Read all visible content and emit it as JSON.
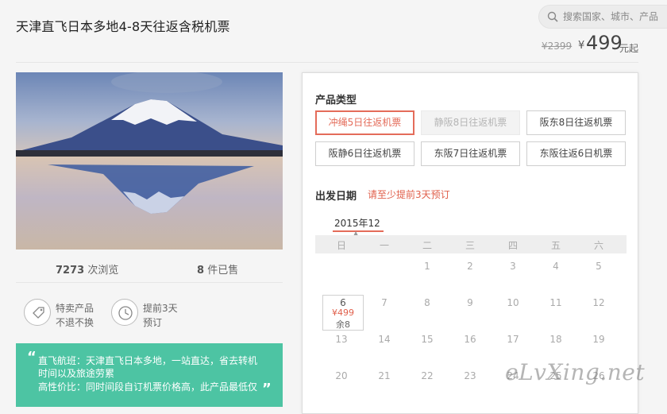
{
  "header": {
    "title": "天津直飞日本多地4-8天往返含税机票",
    "search_placeholder": "搜索国家、城市、产品",
    "old_price": "¥2399",
    "currency": "¥",
    "price": "499",
    "price_suffix": "元起"
  },
  "stats": {
    "views_count": "7273",
    "views_label": "次浏览",
    "sold_count": "8",
    "sold_label": "件已售"
  },
  "features": [
    {
      "icon": "tag-icon",
      "line1": "特卖产品",
      "line2": "不退不换"
    },
    {
      "icon": "clock-icon",
      "line1": "提前3天",
      "line2": "预订"
    }
  ],
  "quote": {
    "line1": "直飞航班：天津直飞日本多地，一站直达，省去转机",
    "line2": "时间以及旅途劳累",
    "line3": "高性价比：同时间段自订机票价格高，此产品最低仅"
  },
  "product_types": {
    "label": "产品类型",
    "options": [
      {
        "label": "冲绳5日往返机票",
        "state": "selected"
      },
      {
        "label": "静阪8日往返机票",
        "state": "disabled"
      },
      {
        "label": "阪东8日往返机票",
        "state": "normal"
      },
      {
        "label": "阪静6日往返机票",
        "state": "normal"
      },
      {
        "label": "东阪7日往返机票",
        "state": "normal"
      },
      {
        "label": "东阪往返6日机票",
        "state": "normal"
      }
    ]
  },
  "departure": {
    "label": "出发日期",
    "hint": "请至少提前3天预订",
    "month": "2015年12",
    "weekdays": [
      "日",
      "一",
      "二",
      "三",
      "四",
      "五",
      "六"
    ],
    "weeks": [
      [
        "",
        "",
        "1",
        "2",
        "3",
        "4",
        "5"
      ],
      [
        "6",
        "7",
        "8",
        "9",
        "10",
        "11",
        "12"
      ],
      [
        "13",
        "14",
        "15",
        "16",
        "17",
        "18",
        "19"
      ],
      [
        "20",
        "21",
        "22",
        "23",
        "24",
        "25",
        "26"
      ]
    ],
    "selected_day": {
      "day": "6",
      "price": "¥499",
      "remaining": "余8"
    }
  },
  "watermark": "eLvXing.net",
  "colors": {
    "accent": "#e46c5a",
    "teal": "#4dc4a3"
  }
}
